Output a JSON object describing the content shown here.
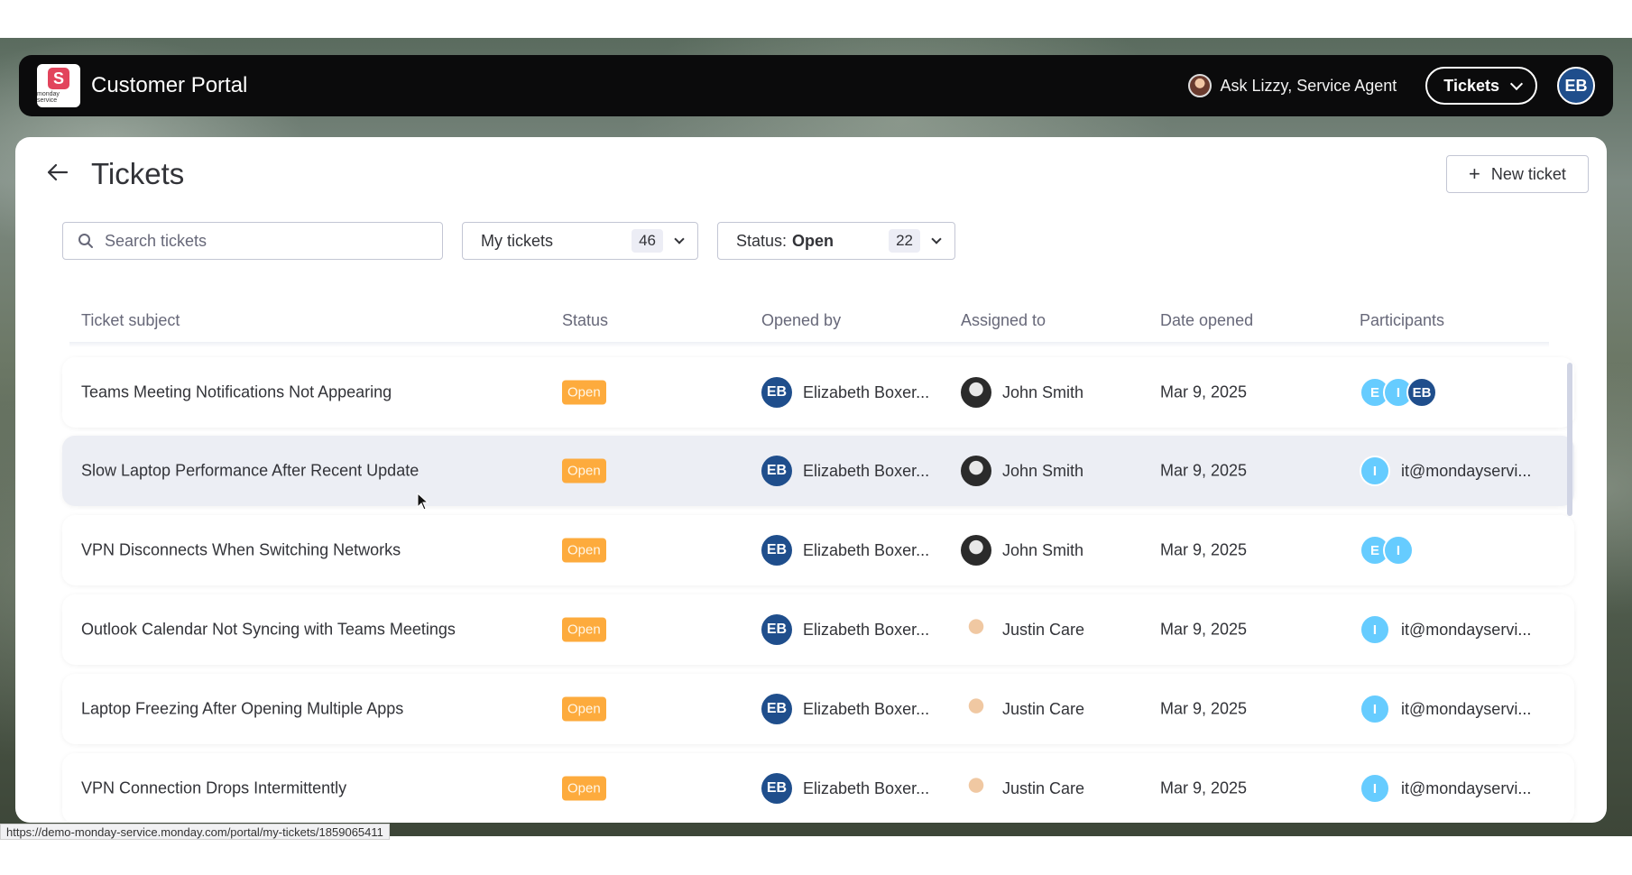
{
  "header": {
    "logo_text": "monday service",
    "app_title": "Customer Portal",
    "ask_lizzy": "Ask Lizzy, Service Agent",
    "tickets_menu": "Tickets",
    "user_initials": "EB"
  },
  "page": {
    "title": "Tickets",
    "new_ticket_label": "New ticket"
  },
  "filters": {
    "search_placeholder": "Search tickets",
    "my_tickets_label": "My tickets",
    "my_tickets_count": "46",
    "status_prefix": "Status:",
    "status_value": "Open",
    "status_count": "22"
  },
  "table": {
    "columns": [
      "Ticket subject",
      "Status",
      "Opened by",
      "Assigned to",
      "Date opened",
      "Participants"
    ],
    "rows": [
      {
        "subject": "Teams Meeting Notifications Not Appearing",
        "status": "Open",
        "opened_initials": "EB",
        "opened_by": "Elizabeth Boxer...",
        "assigned_to": "John Smith",
        "date": "Mar 9, 2025",
        "participants": [
          "E",
          "I",
          "EB"
        ],
        "participant_email": ""
      },
      {
        "subject": "Slow Laptop Performance After Recent Update",
        "status": "Open",
        "opened_initials": "EB",
        "opened_by": "Elizabeth Boxer...",
        "assigned_to": "John Smith",
        "date": "Mar 9, 2025",
        "participants": [
          "I"
        ],
        "participant_email": "it@mondayservi..."
      },
      {
        "subject": "VPN Disconnects When Switching Networks",
        "status": "Open",
        "opened_initials": "EB",
        "opened_by": "Elizabeth Boxer...",
        "assigned_to": "John Smith",
        "date": "Mar 9, 2025",
        "participants": [
          "E",
          "I"
        ],
        "participant_email": ""
      },
      {
        "subject": "Outlook Calendar Not Syncing with Teams Meetings",
        "status": "Open",
        "opened_initials": "EB",
        "opened_by": "Elizabeth Boxer...",
        "assigned_to": "Justin Care",
        "date": "Mar 9, 2025",
        "participants": [
          "I"
        ],
        "participant_email": "it@mondayservi..."
      },
      {
        "subject": "Laptop Freezing After Opening Multiple Apps",
        "status": "Open",
        "opened_initials": "EB",
        "opened_by": "Elizabeth Boxer...",
        "assigned_to": "Justin Care",
        "date": "Mar 9, 2025",
        "participants": [
          "I"
        ],
        "participant_email": "it@mondayservi..."
      },
      {
        "subject": "VPN Connection Drops Intermittently",
        "status": "Open",
        "opened_initials": "EB",
        "opened_by": "Elizabeth Boxer...",
        "assigned_to": "Justin Care",
        "date": "Mar 9, 2025",
        "participants": [
          "I"
        ],
        "participant_email": "it@mondayservi..."
      }
    ]
  },
  "status_bar_url": "https://demo-monday-service.monday.com/portal/my-tickets/1859065411",
  "colors": {
    "topbar": "#0b0b0c",
    "open_badge": "#fdab3d",
    "avatar_dark": "#1f4e8c",
    "avatar_light": "#66ccff"
  }
}
